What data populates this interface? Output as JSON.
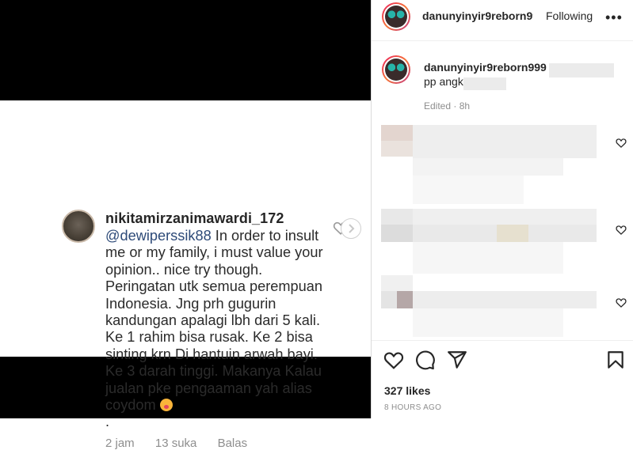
{
  "comment": {
    "username": "nikitamirzanimawardi_172",
    "mention": "@dewiperssik88",
    "text": " In order to insult me or my family, i must value your opinion.. nice try though. Peringatan utk semua perempuan Indonesia. Jng prh gugurin kandungan apalagi lbh dari 5 kali. Ke 1 rahim bisa rusak. Ke 2 bisa sinting krn Di hantuin arwah bayi. Ke 3 darah tinggi. Makanya Kalau jualan pke pengaaman yah alias coydom ",
    "text_end": ".",
    "time": "2 jam",
    "likes": "13 suka",
    "reply": "Balas"
  },
  "header": {
    "username": "danunyinyir9reborn999",
    "following": "Following",
    "more": "•••"
  },
  "caption": {
    "username": "danunyinyir9reborn999",
    "text": "pp angkat",
    "edited": "Edited · 8h"
  },
  "post": {
    "likes": "327 likes",
    "timestamp": "8 HOURS AGO"
  },
  "icons": [
    "heart-icon",
    "comment-icon",
    "share-icon",
    "bookmark-icon",
    "chevron-right-icon",
    "more-icon"
  ],
  "colors": {
    "accent": "#262626",
    "secondary": "#8e8e8e",
    "mention": "#2d4a78"
  }
}
